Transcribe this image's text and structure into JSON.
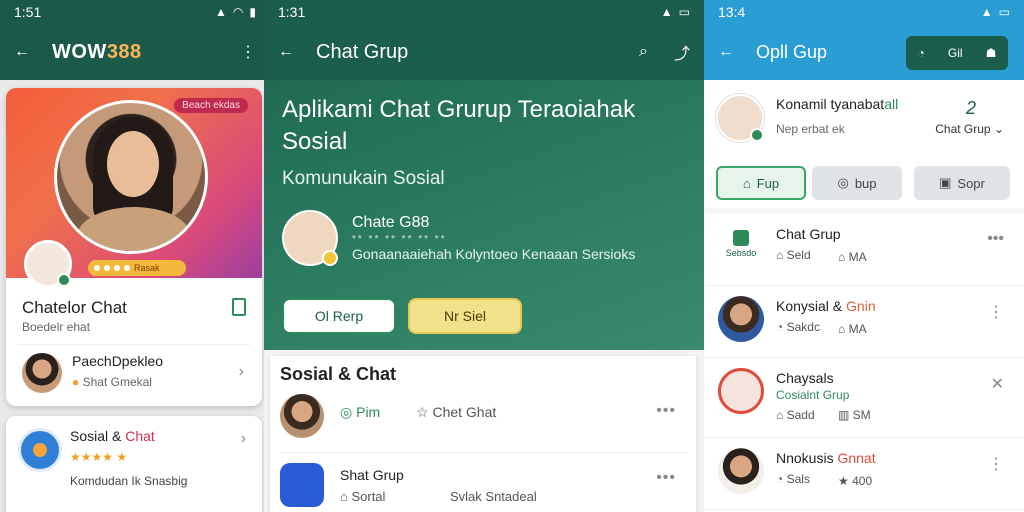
{
  "colors": {
    "green_dark": "#1b5e4b",
    "green_accent": "#2e8b57",
    "blue_bar": "#2a9ed4",
    "yellow": "#f2e08a",
    "orange": "#ffb35a"
  },
  "p1": {
    "time": "1:51",
    "title_a": "WOW",
    "title_b": "388",
    "tag": "Beach ekdas",
    "pill": "Rasak",
    "hero_title": "Chatelor Chat",
    "hero_sub": "Boedelr ehat",
    "row_title": "PaechDpekleo",
    "row_sub": "Shat Gmekal",
    "card_title_a": "Sosial & ",
    "card_title_b": "Chat",
    "card_stars": "★★★★ ★",
    "card_sub": "Komdudan Ik Snasbig"
  },
  "p2": {
    "time": "1:31",
    "title": "Chat Grup",
    "headline": "Aplikami Chat Grurup Teraoiahak Sosial",
    "subline": "Komunukain Sosial",
    "user_name": "Chate G88",
    "user_meta": "** ** ** ** ** **",
    "user_desc": "Gonaanaaiehah Kolyntoeo Kenaaan Sersioks",
    "btn1": "Ol Rerp",
    "btn2": "Nr Siel",
    "section": "Sosial & Chat",
    "r1_a": "Pim",
    "r1_b": "Chet Ghat",
    "r2_title": "Shat Grup",
    "r2_s1": "Sortal",
    "r2_s2": "Svlak Sntadeal"
  },
  "p3": {
    "time": "13:4",
    "title": "Opll Gup",
    "new_label": "Gil",
    "name_a": "Konamil tyanabat",
    "name_b": "all",
    "sub": "Nep erbat ek",
    "num": "2",
    "chat_grup": "Chat Grup",
    "chip1": "Fup",
    "chip2": "bup",
    "chip3": "Sopr",
    "rows": [
      {
        "t": "Chat Grup",
        "logo": "Sebsdo",
        "s1": "Seld",
        "s2": "MA"
      },
      {
        "t_a": "Konysial & ",
        "t_b": "Gnin",
        "s1": "Sakdc",
        "s2": "MA"
      },
      {
        "t": "Chaysals",
        "sub_green": "Cosialnt Grup",
        "s1": "Sadd",
        "s2": "SM"
      },
      {
        "t_a": "Nnokusis ",
        "t_b": "Gnnat",
        "s1": "Sals",
        "s2": "400"
      }
    ]
  }
}
